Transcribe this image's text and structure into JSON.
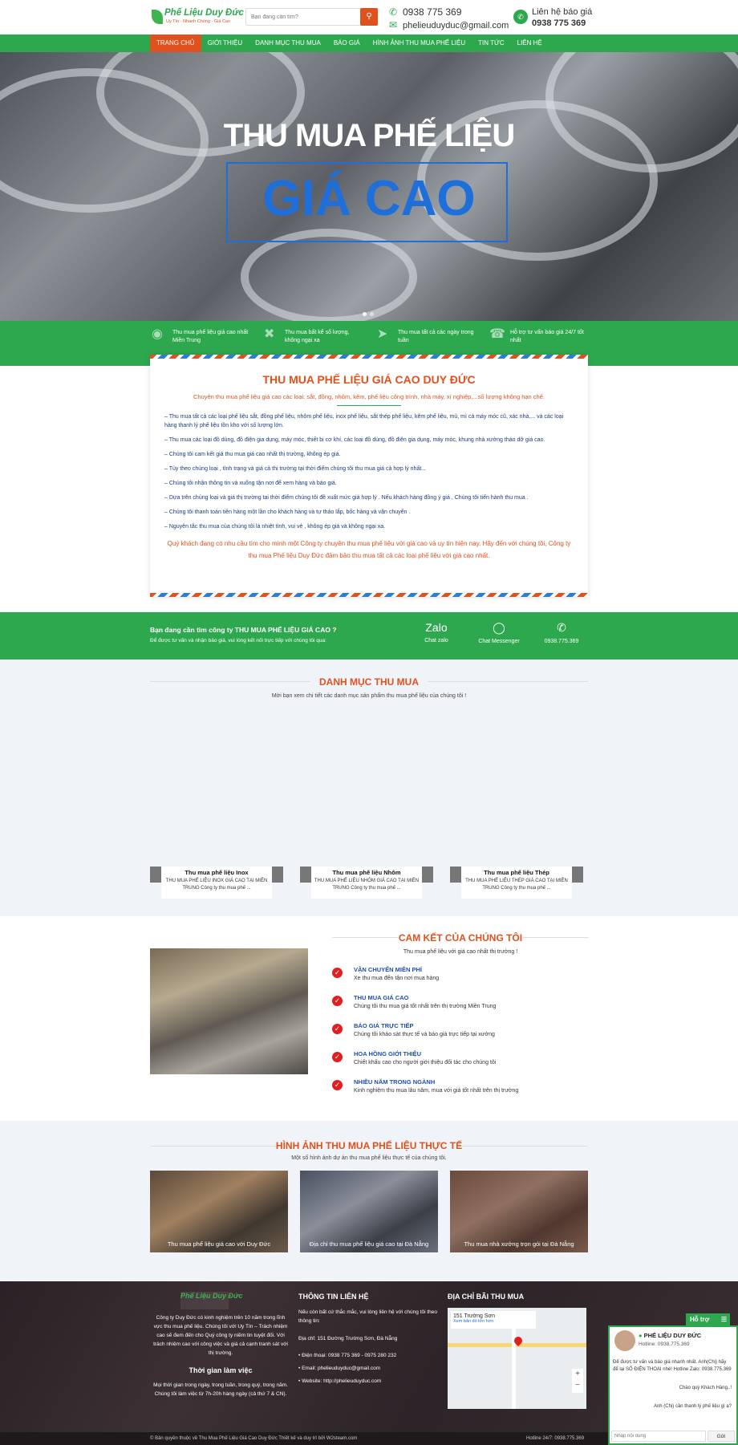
{
  "header": {
    "logo_name": "Phế Liệu Duy Đức",
    "logo_tagline": "Uy Tín - Nhanh Chóng - Giá Cao",
    "search_placeholder": "Bạn đang cần tìm?",
    "phone": "0938 775 369",
    "email": "phelieuduyduc@gmail.com",
    "contact_label": "Liên hệ báo giá",
    "contact_phone": "0938 775 369"
  },
  "nav": [
    "TRANG CHỦ",
    "GIỚI THIỆU",
    "DANH MỤC THU MUA",
    "BÁO GIÁ",
    "HÌNH ẢNH THU MUA PHẾ LIỆU",
    "TIN TỨC",
    "LIÊN HỆ"
  ],
  "hero": {
    "title": "THU MUA PHẾ LIỆU",
    "highlight": "GIÁ CAO"
  },
  "features": [
    {
      "icon": "globe-icon",
      "text": "Thu mua phế liệu giá cao nhất Miền Trung"
    },
    {
      "icon": "tools-icon",
      "text": "Thu mua bất kể số lượng, không ngại xa"
    },
    {
      "icon": "send-icon",
      "text": "Thu mua tất cả các ngày trong tuần"
    },
    {
      "icon": "headset-icon",
      "text": "Hỗ trợ tư vấn báo giá 24/7 tốt nhất"
    }
  ],
  "about": {
    "title": "THU MUA PHẾ LIỆU GIÁ CAO DUY ĐỨC",
    "subtitle": "Chuyên thu mua phế liệu giá cao các loại: sắt, đồng, nhôm, kẽm, phế liệu công trình, nhà máy, xí nghiệp,...số lượng không hạn chế.",
    "items": [
      "– Thu mua tất cả các loại phế liệu sắt, đồng phế liệu, nhôm phế liệu, inox phế liệu, sắt thép phế liệu, kẽm phế liệu, mủ, mì cá máy móc cũ, xác nhà,... và các loại hàng thanh lý phế liệu tồn kho với số lượng lớn.",
      "– Thu mua các loại đồ dùng, đồ điện gia dụng, máy móc, thiết bị cơ khí, các loại đồ dùng, đồ điện gia dụng, máy móc, khung nhà xưởng tháo dỡ giá cao.",
      "– Chúng tôi cam kết giá thu mua giá cao nhất thị trường, không ép giá.",
      "– Tùy theo chủng loại , tình trạng và giá cả thị trường tại thời điểm chúng tôi thu mua giá cả hợp lý nhất...",
      "– Chúng tôi nhận thông tin và xuống tận nơi để xem hàng và báo giá.",
      "– Dựa trên chủng loại và giá thị trường tại thời điểm chúng tôi đề xuất mức giá hợp lý . Nếu khách hàng đồng ý giá , Chúng tôi tiến hành thu mua .",
      "– Chúng tôi thanh toán tiền hàng một lần cho khách hàng và tự tháo lắp, bốc hàng và vận chuyển .",
      "– Nguyên tắc thu mua của chúng tôi là nhiệt tình, vui vẻ , không ép giá và không ngại xa."
    ],
    "cta": "Quý khách đang có nhu cầu tìm cho mình một Công ty chuyên thu mua phế liệu với giá cao và uy tín hiện nay. Hãy đến với chúng tôi, Công ty thu mua Phế liệu Duy Đức đảm bảo thu mua tất cả các loại phế liệu với giá cao nhất."
  },
  "band": {
    "title": "Bạn đang cần tìm công ty THU MUA PHẾ LIỆU GIÁ CAO ?",
    "sub": "Để được tư vấn và nhận báo giá, vui lòng kết nối trực tiếp với chúng tôi qua:",
    "zalo": "Chat zalo",
    "messenger": "Chat Messenger",
    "phone": "0938.775.369"
  },
  "categories": {
    "title": "DANH MỤC THU MUA",
    "sub": "Mời bạn xem chi tiết các danh mục sản phẩm thu mua phế liệu của chúng tôi !",
    "cards": [
      {
        "title": "Thu mua phế liệu Inox",
        "desc": "THU MUA PHẾ LIỆU INOX GIÁ CAO TẠI MIỀN TRUNG Công ty thu mua phế ..."
      },
      {
        "title": "Thu mua phế liệu Nhôm",
        "desc": "THU MUA PHẾ LIỆU NHÔM GIÁ CAO TẠI MIỀN TRUNG Công ty thu mua phế ..."
      },
      {
        "title": "Thu mua phế liệu Thép",
        "desc": "THU MUA PHẾ LIỆU THÉP GIÁ CAO TẠI MIỀN TRUNG Công ty thu mua phế ..."
      }
    ]
  },
  "commit": {
    "title": "CAM KẾT CỦA CHÚNG TÔI",
    "sub": "Thu mua phế liệu với giá cao nhất thị trường !",
    "items": [
      {
        "name": "VẬN CHUYỂN MIỄN PHÍ",
        "desc": "Xe thu mua đến tận nơi mua hàng"
      },
      {
        "name": "THU MUA GIÁ CAO",
        "desc": "Chúng tôi thu mua giá tốt nhất trên thị trường Miền Trung"
      },
      {
        "name": "BÁO GIÁ TRỰC TIẾP",
        "desc": "Chúng tôi khảo sát thực tế và báo giá trực tiếp tại xưởng"
      },
      {
        "name": "HOA HỒNG GIỚI THIỆU",
        "desc": "Chiết khấu cao cho người giới thiệu đối tác cho chúng tôi"
      },
      {
        "name": "NHIỀU NĂM TRONG NGÀNH",
        "desc": "Kinh nghiệm thu mua lâu năm, mua với giá tốt nhất trên thị trường"
      }
    ]
  },
  "gallery": {
    "title": "HÌNH ẢNH THU MUA PHẾ LIỆU THỰC TẾ",
    "sub": "Một số hình ảnh dự án thu mua phế liệu thực tế của chúng tôi.",
    "items": [
      "Thu mua phế liệu giá cao với Duy Đức",
      "Địa chỉ thu mua phế liệu giá cao tại Đà Nẵng",
      "Thu mua nhà xưởng trọn gói tại Đà Nẵng"
    ]
  },
  "footer": {
    "about": "Công ty Duy Đức có kinh nghiệm trên 10 năm trong lĩnh vực thu mua phế liệu. Chúng tôi với Uy Tín – Trách nhiệm cao sẽ đem đến cho Quý công ty niềm tin tuyệt đối. Với trách nhiệm cao với công việc và giá cả cạnh tranh sát với thị trường.",
    "hours_title": "Thời gian làm việc",
    "hours": "Mọi thời gian trong ngày, trong tuần, trong quý, trong năm. Chúng tôi làm việc từ 7h-20h hàng ngày (cả thứ 7 & CN).",
    "contact_title": "THÔNG TIN LIÊN HỆ",
    "contact_intro": "Nếu còn bất cứ thắc mắc, vui lòng liên hệ với chúng tôi theo thông tin:",
    "address": "Địa chỉ: 151 Đường Trường Sơn, Đà Nẵng",
    "phone": "Điện thoại: 0938 775 369 - 0975 280 232",
    "email": "Email: phelieuduyduc@gmail.com",
    "website": "Website: http://phelieuduyduc.com",
    "map_title": "ĐỊA CHỈ BÃI THU MUA",
    "map_place": "151 Trường Sơn",
    "map_link": "Xem bản đồ lớn hơn",
    "copyright": "© Bản quyền thuộc về Thu Mua Phế Liệu Giá Cao Duy Đức Thiết kế và duy trì bởi W2steam.com",
    "hotline": "Hotline 24/7: 0938.775.369"
  },
  "chat": {
    "tab": "Hỗ trợ",
    "name": "PHẾ LIỆU DUY ĐỨC",
    "hotline": "Hotline: 0938.775.369",
    "msg1": "Để được tư vấn và báo giá nhanh nhất. Anh(Chị) hãy để lại SỐ ĐIỆN THOẠI nhé! Hotline Zalo: 0938.775.369",
    "msg2": "Chào quý Khách Hàng..!",
    "msg3": "Anh (Chị) cần thanh lý phế liệu gì ạ?",
    "input_placeholder": "Nhập nội dung",
    "send": "Gửi"
  }
}
